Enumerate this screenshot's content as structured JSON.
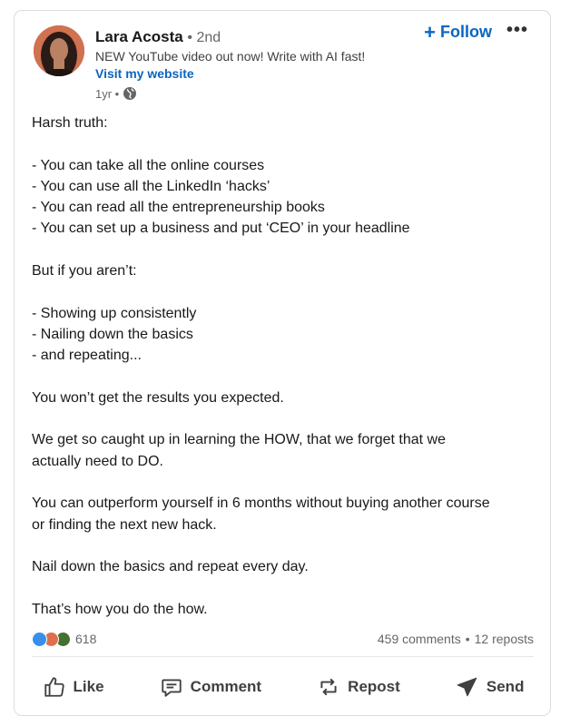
{
  "author": {
    "name": "Lara Acosta",
    "degree": "• 2nd",
    "tagline": "NEW YouTube video out now! Write with AI fast!",
    "website_label": "Visit my website",
    "age": "1yr •"
  },
  "header_actions": {
    "follow_label": "Follow",
    "more_label": "•••"
  },
  "post": {
    "lines": [
      "Harsh truth:",
      "",
      "- You can take all the online courses",
      "- You can use all the LinkedIn ‘hacks’",
      "- You can read all the entrepreneurship books",
      "- You can set up a business and put ‘CEO’ in your headline",
      "",
      "But if you aren’t:",
      "",
      "- Showing up consistently",
      "- Nailing down the basics",
      "- and repeating...",
      "",
      "You won’t get the results you expected.",
      "",
      "We get so caught up in learning the HOW, that we forget that we",
      "actually need to DO.",
      "",
      "You can outperform yourself in 6 months without buying another course",
      "or finding the next new hack.",
      "",
      "Nail down the basics and repeat every day.",
      "",
      "That’s how you do the how."
    ]
  },
  "social": {
    "reaction_count": "618",
    "comments": "459 comments",
    "separator": "•",
    "reposts": "12 reposts",
    "reaction_icons": [
      "like-icon",
      "love-icon",
      "celebrate-icon"
    ]
  },
  "actions": {
    "like": "Like",
    "comment": "Comment",
    "repost": "Repost",
    "send": "Send"
  },
  "colors": {
    "link": "#0a66c2",
    "text": "#191919",
    "muted": "#666666"
  }
}
